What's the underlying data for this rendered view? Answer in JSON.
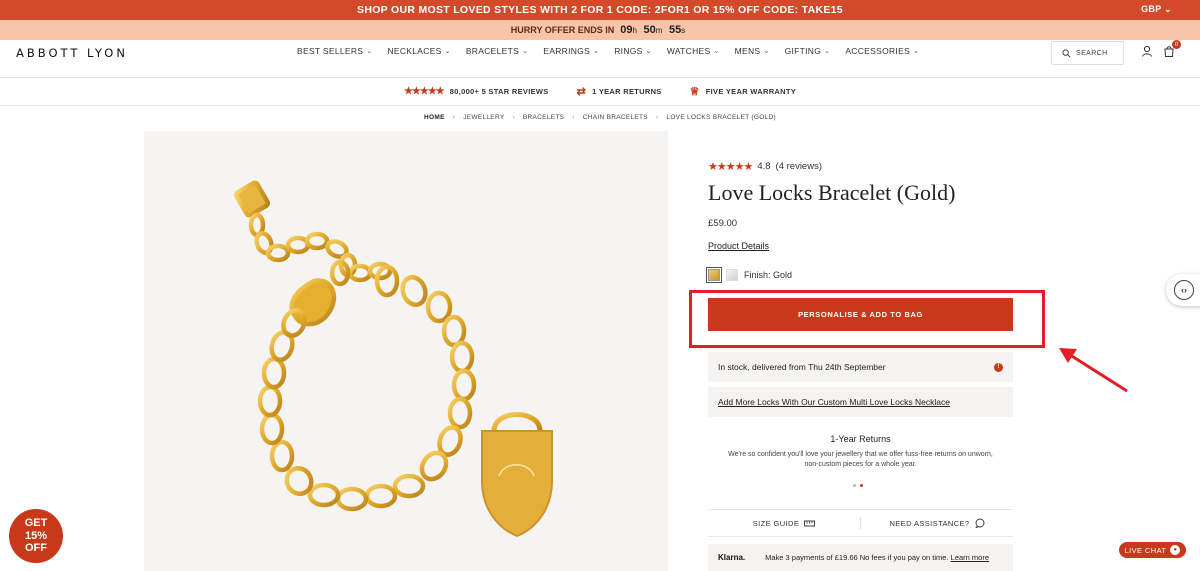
{
  "promo": {
    "text": "SHOP OUR MOST LOVED STYLES WITH 2 FOR 1 CODE: 2FOR1 OR 15% OFF CODE: TAKE15",
    "currency": "GBP"
  },
  "timer": {
    "label": "HURRY OFFER ENDS IN",
    "hours": "09",
    "hours_unit": "h",
    "minutes": "50",
    "minutes_unit": "m",
    "seconds": "55",
    "seconds_unit": "s"
  },
  "header": {
    "logo": "ABBOTT LYON",
    "nav": [
      {
        "label": "BEST SELLERS"
      },
      {
        "label": "NECKLACES"
      },
      {
        "label": "BRACELETS"
      },
      {
        "label": "EARRINGS"
      },
      {
        "label": "RINGS"
      },
      {
        "label": "WATCHES"
      },
      {
        "label": "MENS"
      },
      {
        "label": "GIFTING"
      },
      {
        "label": "ACCESSORIES"
      }
    ],
    "search_label": "SEARCH",
    "bag_count": "0"
  },
  "usp": {
    "reviews": "80,000+ 5 STAR REVIEWS",
    "returns": "1 YEAR RETURNS",
    "warranty": "FIVE YEAR WARRANTY"
  },
  "breadcrumb": [
    "HOME",
    "JEWELLERY",
    "BRACELETS",
    "CHAIN BRACELETS",
    "LOVE LOCKS BRACELET (GOLD)"
  ],
  "product": {
    "rating": "4.8",
    "reviews": "(4 reviews)",
    "title": "Love Locks Bracelet (Gold)",
    "price": "£59.00",
    "details_link": "Product Details",
    "finish_label": "Finish:",
    "finish_value": "Gold",
    "add_button": "PERSONALISE & ADD TO BAG",
    "stock_text": "In stock, delivered from Thu 24th September",
    "locks_link": "Add More Locks With Our Custom Multi Love Locks Necklace",
    "returns_title": "1-Year Returns",
    "returns_text": "We're so confident you'll love your jewellery that we offer fuss-free returns on unworn, non-custom pieces for a whole year.",
    "size_guide": "SIZE GUIDE",
    "need_assistance": "NEED ASSISTANCE?",
    "klarna_logo": "Klarna.",
    "klarna_text": "Make 3 payments of £19.66 No fees if you pay on time.",
    "klarna_link": "Learn more"
  },
  "badge": {
    "line1": "GET",
    "line2": "15%",
    "line3": "OFF"
  },
  "live_chat": "LIVE CHAT",
  "colors": {
    "brand": "#c8381a",
    "promo_bar": "#d24a2a",
    "timer_bar": "#f9c4a8",
    "annotation": "#e21f26"
  }
}
